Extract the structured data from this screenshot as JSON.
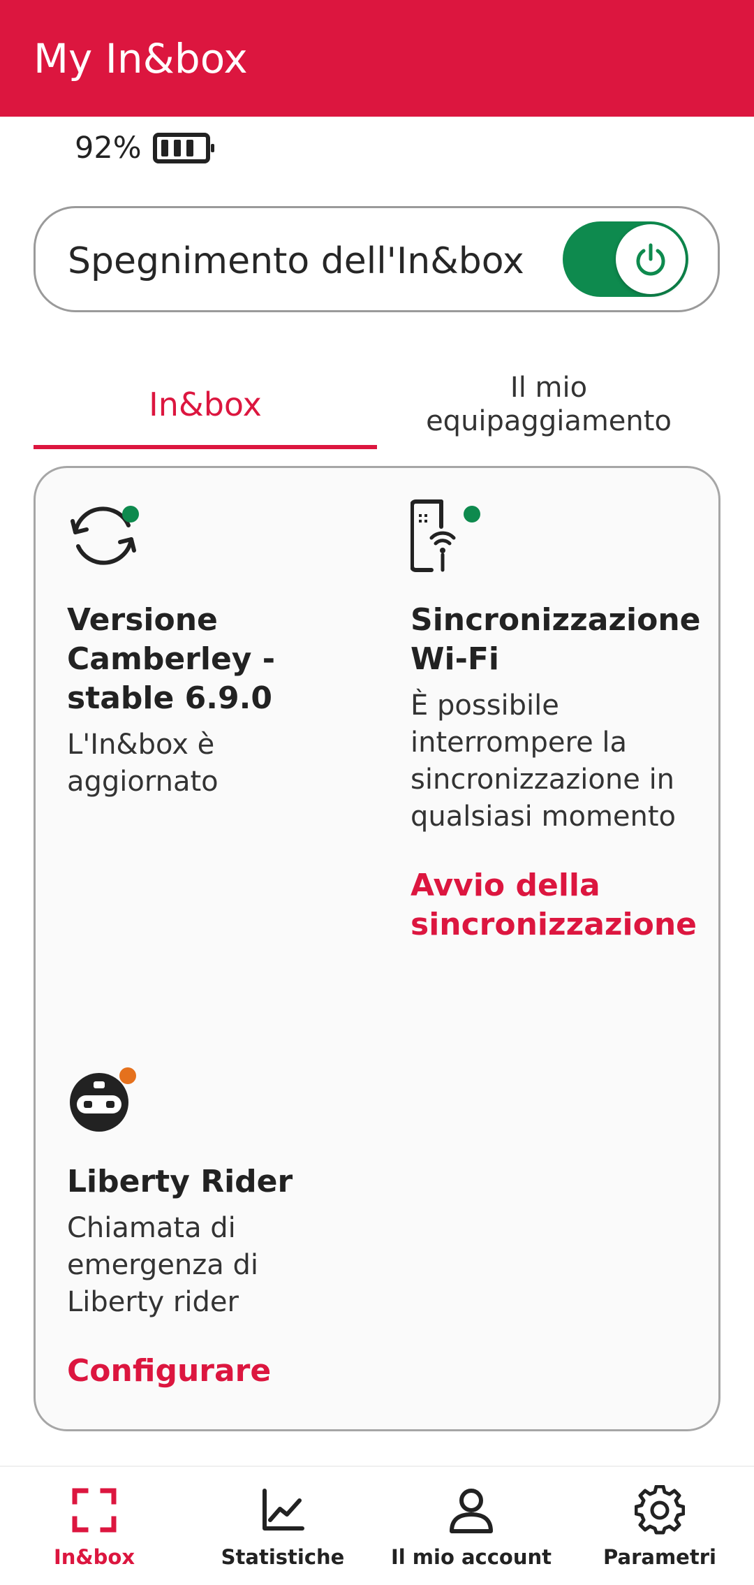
{
  "app": {
    "title": "My In&box"
  },
  "battery": {
    "percent": "92%"
  },
  "power": {
    "label": "Spegnimento dell'In&box",
    "enabled": true
  },
  "tabs": [
    {
      "label": "In&box",
      "active": true
    },
    {
      "label": "Il mio equipaggiamento",
      "active": false
    }
  ],
  "features": {
    "version": {
      "title": "Versione Camberley - stable 6.9.0",
      "description": "L'In&box è aggiornato",
      "status_color": "#0e8a4e"
    },
    "wifi": {
      "title": "Sincronizzazione Wi-Fi",
      "description": "È possibile interrompere la sincronizzazione in qualsiasi momento",
      "action": "Avvio della sincronizzazione",
      "status_color": "#0e8a4e"
    },
    "liberty": {
      "title": "Liberty Rider",
      "description": "Chiamata di emergenza di Liberty rider",
      "action": "Configurare",
      "status_color": "#e5711d"
    }
  },
  "nav": [
    {
      "label": "In&box",
      "icon": "inbox-frame-icon",
      "active": true
    },
    {
      "label": "Statistiche",
      "icon": "chart-line-icon",
      "active": false
    },
    {
      "label": "Il mio account",
      "icon": "user-icon",
      "active": false
    },
    {
      "label": "Parametri",
      "icon": "gear-icon",
      "active": false
    }
  ],
  "colors": {
    "brand": "#dc163f",
    "toggle_on": "#0e8a4e",
    "status_ok": "#0e8a4e",
    "status_warn": "#e5711d"
  }
}
